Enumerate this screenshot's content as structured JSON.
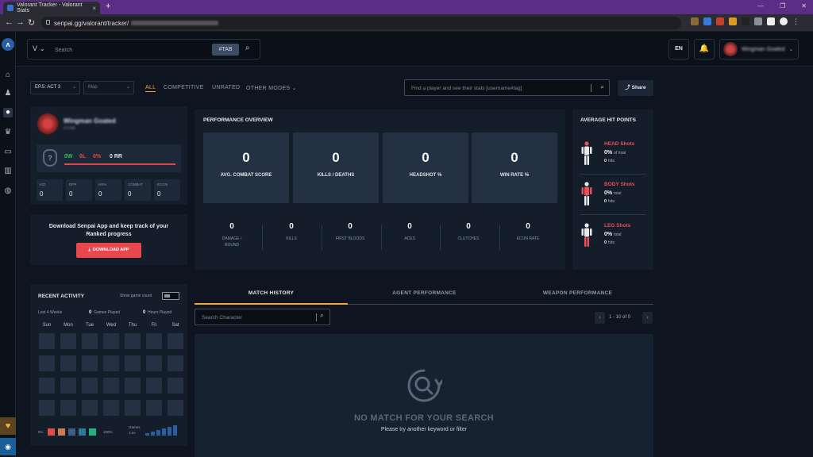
{
  "browser": {
    "tab_title": "Valorant Tracker - Valorant Stats",
    "url": "senpai.gg/valorant/tracker/",
    "new_tab": "+"
  },
  "header": {
    "search_placeholder": "Search",
    "tag_pill": "#TAB",
    "lang": "EN",
    "user_name": "Wingman Goated"
  },
  "filters": {
    "season": "EP.5: ACT 3",
    "map_placeholder": "Map",
    "modes": [
      "ALL",
      "COMPETITIVE",
      "UNRATED",
      "OTHER MODES"
    ],
    "active_mode": "ALL",
    "player_search_placeholder": "Find a player and see their stats [username#tag]",
    "share": "Share"
  },
  "profile": {
    "name": "Wingman Goated",
    "tag": "#TAB",
    "rank_icon": "?",
    "wins": "0W",
    "losses": "0L",
    "win_pct": "0%",
    "rr": "0 RR",
    "stats": [
      {
        "label": "K/D",
        "value": "0"
      },
      {
        "label": "DPR",
        "value": "0"
      },
      {
        "label": "HS%",
        "value": "0"
      },
      {
        "label": "COMBAT",
        "value": "0"
      },
      {
        "label": "ECON",
        "value": "0"
      }
    ]
  },
  "promo": {
    "text": "Download Senpai App and keep track of your Ranked progress",
    "button": "DOWNLOAD APP"
  },
  "activity": {
    "title": "RECENT ACTIVITY",
    "toggle_label": "Show game count",
    "period": "Last 4 Weeks",
    "games_played_value": "0",
    "games_played_label": "Games Played",
    "hours_played_value": "0",
    "hours_played_label": "Hours Played",
    "days": [
      "Sun",
      "Mon",
      "Tue",
      "Wed",
      "Thu",
      "Fri",
      "Sat"
    ],
    "legend_min": "0%",
    "legend_max": "100%",
    "legend_colors": [
      "#e04b4b",
      "#d17b4d",
      "#3f5f86",
      "#2a7a9c",
      "#22b27a"
    ],
    "games_label": "Games",
    "games_range": "1-5+"
  },
  "performance": {
    "title": "PERFORMANCE OVERVIEW",
    "big": [
      {
        "value": "0",
        "label": "AVG. COMBAT SCORE"
      },
      {
        "value": "0",
        "label": "KILLS / DEATHS"
      },
      {
        "value": "0",
        "label": "HEADSHOT %"
      },
      {
        "value": "0",
        "label": "WIN RATE %"
      }
    ],
    "small": [
      {
        "value": "0",
        "label": "DAMAGE / ROUND"
      },
      {
        "value": "0",
        "label": "KILLS"
      },
      {
        "value": "0",
        "label": "FIRST BLOODS"
      },
      {
        "value": "0",
        "label": "ACES"
      },
      {
        "value": "0",
        "label": "CLUTCHES"
      },
      {
        "value": "0",
        "label": "ECON RATE"
      }
    ]
  },
  "hit_points": {
    "title": "AVERAGE HIT POINTS",
    "items": [
      {
        "name": "HEAD Shots",
        "pct": "0%",
        "pct_suffix": "of total",
        "hits": "0",
        "hits_label": "hits"
      },
      {
        "name": "BODY Shots",
        "pct": "0%",
        "pct_suffix": "total",
        "hits": "0",
        "hits_label": "hits"
      },
      {
        "name": "LEG Shots",
        "pct": "0%",
        "pct_suffix": "total",
        "hits": "0",
        "hits_label": "hits"
      }
    ]
  },
  "tabs": [
    "MATCH HISTORY",
    "AGENT PERFORMANCE",
    "WEAPON PERFORMANCE"
  ],
  "match": {
    "search_placeholder": "Search Character",
    "pagination": "1 - 10 of 0",
    "empty_title": "NO MATCH FOR YOUR SEARCH",
    "empty_sub": "Please try another keyword or filter"
  },
  "colors": {
    "accent": "#f2a64a",
    "danger": "#e9474c",
    "win": "#22c55e"
  }
}
